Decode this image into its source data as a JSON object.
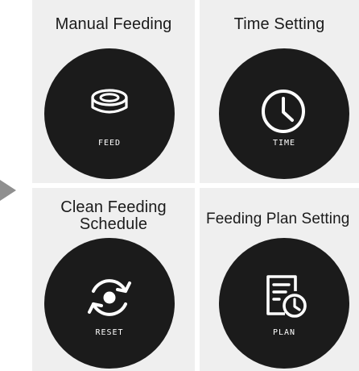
{
  "colors": {
    "panel_bg": "#efefef",
    "dial_bg": "#1b1b1b",
    "icon_stroke": "#ffffff",
    "pointer": "#8f8f8f",
    "title_text": "#1b1b1b"
  },
  "panels": {
    "feed": {
      "title": "Manual Feeding",
      "label": "FEED",
      "icon": "bowl-icon"
    },
    "time": {
      "title": "Time Setting",
      "label": "TIME",
      "icon": "clock-icon"
    },
    "reset": {
      "title": "Clean Feeding\nSchedule",
      "label": "RESET",
      "icon": "reset-icon"
    },
    "plan": {
      "title": "Feeding Plan Setting",
      "label": "PLAN",
      "icon": "plan-schedule-icon"
    }
  }
}
